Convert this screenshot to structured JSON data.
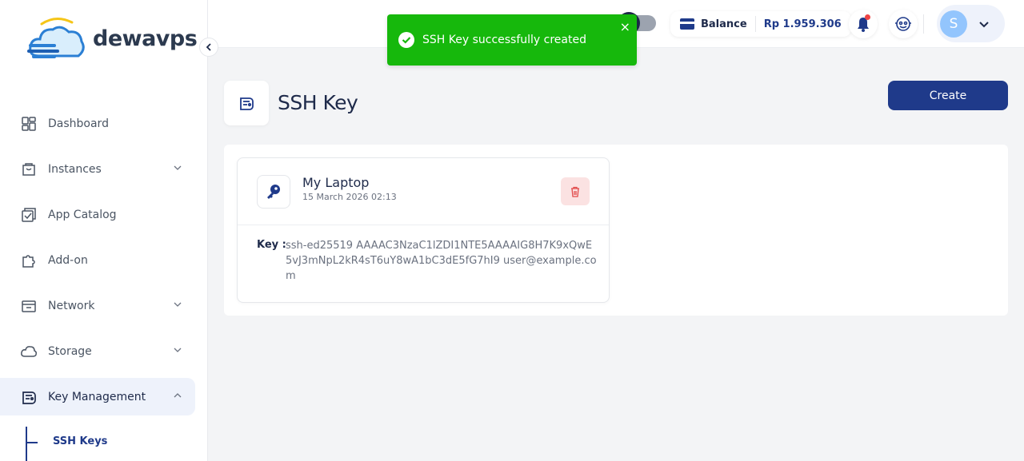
{
  "brand": {
    "name": "dewavps"
  },
  "sidebar": {
    "items": [
      {
        "label": "Dashboard",
        "icon": "dashboard-icon",
        "has_submenu": false
      },
      {
        "label": "Instances",
        "icon": "instances-icon",
        "has_submenu": true
      },
      {
        "label": "App Catalog",
        "icon": "app-catalog-icon",
        "has_submenu": false
      },
      {
        "label": "Add-on",
        "icon": "addon-puzzle-icon",
        "has_submenu": false
      },
      {
        "label": "Network",
        "icon": "network-icon",
        "has_submenu": true
      },
      {
        "label": "Storage",
        "icon": "cloud-storage-icon",
        "has_submenu": true
      },
      {
        "label": "Key Management",
        "icon": "key-management-icon",
        "has_submenu": true,
        "expanded": true,
        "active": true
      }
    ],
    "subitems": [
      {
        "label": "SSH Keys",
        "active": true
      }
    ]
  },
  "header": {
    "balance_label": "Balance",
    "balance_value": "Rp 1.959.306",
    "avatar_initial": "S"
  },
  "toast": {
    "message": "SSH Key successfully created",
    "close": "×",
    "color": "#16b80c"
  },
  "page": {
    "title": "SSH Key",
    "create_label": "Create"
  },
  "ssh_keys": [
    {
      "name": "My Laptop",
      "created": "15 March 2026 02:13",
      "key_label": "Key :",
      "key": "ssh-ed25519 AAAAC3NzaC1lZDI1NTE5AAAAIG8H7K9xQwE5vJ3mNpL2kR4sT6uY8wA1bC3dE5fG7hI9 user@example.com"
    }
  ],
  "colors": {
    "primary": "#1f3a8a",
    "accent_light": "#eef2fb",
    "danger_light": "#fbe2e2"
  }
}
